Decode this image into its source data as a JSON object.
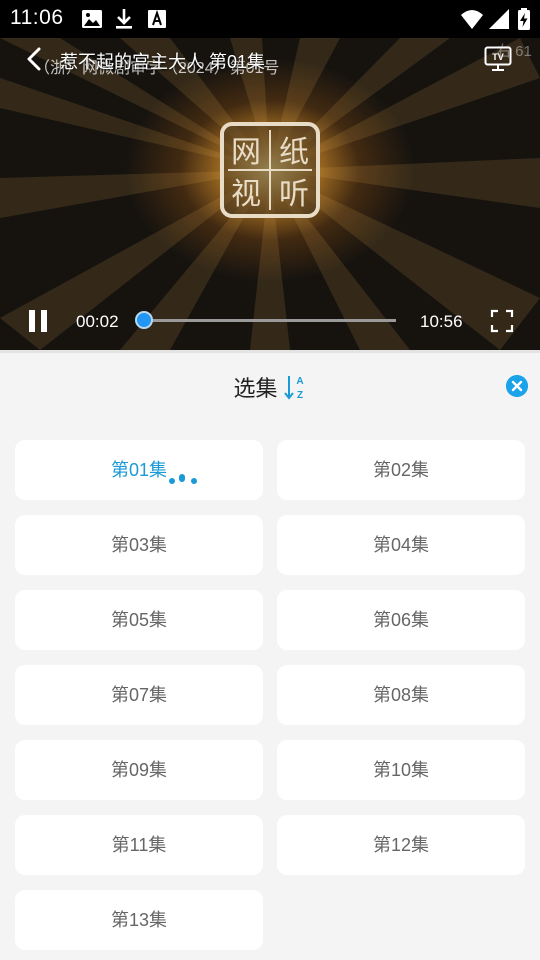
{
  "status_bar": {
    "time": "11:06",
    "icons": [
      "image-icon",
      "download-icon",
      "a-box-icon",
      "wifi-icon",
      "signal-icon",
      "battery-charging-icon"
    ]
  },
  "player": {
    "title": "惹不起的宫主大人 第01集",
    "subtitle": "（浙）网微剧审字（2024）第01号",
    "watermark_text": "右 61",
    "logo_text": "网纸 视听",
    "current_time": "00:02",
    "duration": "10:56",
    "progress": 0.003,
    "state": "playing",
    "back_icon": "chevron-left-icon",
    "cast_icon": "tv-icon",
    "fullscreen_icon": "fullscreen-icon"
  },
  "episodes_panel": {
    "title": "选集",
    "sort_icon": "sort-az-icon",
    "close_icon": "close-circle-icon",
    "accent_color": "#1a9ad6",
    "selected_index": 0,
    "episodes": [
      "第01集",
      "第02集",
      "第03集",
      "第04集",
      "第05集",
      "第06集",
      "第07集",
      "第08集",
      "第09集",
      "第10集",
      "第11集",
      "第12集",
      "第13集"
    ]
  }
}
